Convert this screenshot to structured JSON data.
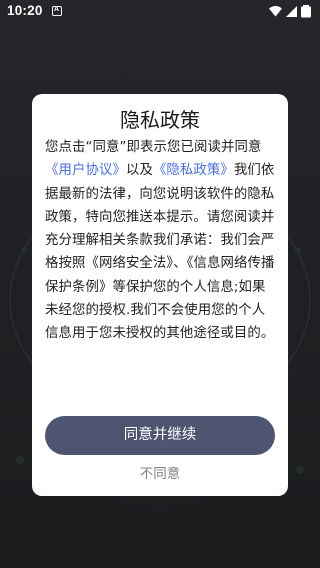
{
  "status_bar": {
    "time": "10:20",
    "notification_icon": "A",
    "icons": [
      "wifi-icon",
      "cellular-signal-icon",
      "battery-icon"
    ]
  },
  "dialog": {
    "title": "隐私政策",
    "body": {
      "intro_prefix": "您点击“同意”即表示您已阅读并同意",
      "link_user_agreement": "《用户协议》",
      "and_text": "以及",
      "link_privacy_policy": "《隐私政策》",
      "intro_suffix": "我们依据最新的法律，向您说明该软件的隐私政策，特向您推送本提示。请您阅读并充分理解相关条款",
      "commitment_heading": "我们承诺：",
      "commitment_part1": "我们会严格按照《网络安全法》、《信息网络传播保护条例》等保护您的个人信息;如果未经您的授权.",
      "commitment_part2": "我们不会使用您的个人信息用于您未授权的其他途径或目的。"
    },
    "agree_label": "同意并继续",
    "disagree_label": "不同意"
  },
  "colors": {
    "link": "#4a6ed6",
    "agree_button_bg": "#4e5571",
    "disagree_text": "#808080",
    "background": "#232427"
  }
}
